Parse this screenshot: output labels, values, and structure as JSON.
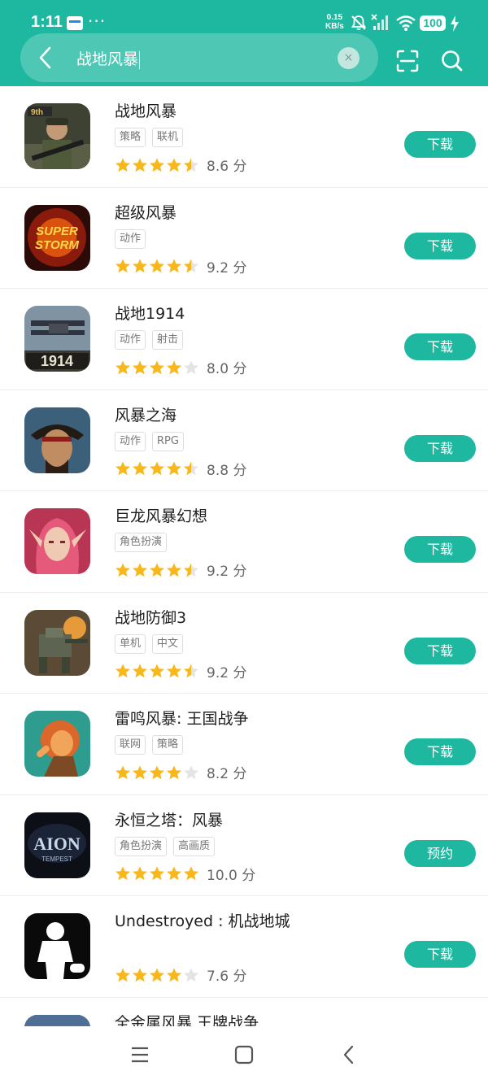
{
  "status_bar": {
    "time": "1:11",
    "more": "···",
    "net_speed_value": "0.15",
    "net_speed_unit": "KB/s",
    "battery": "100",
    "icons": [
      "calendar-icon",
      "mute-icon",
      "no-sim-signal-icon",
      "wifi-icon",
      "charging-icon"
    ]
  },
  "search": {
    "query": "战地风暴",
    "clear_label": "×",
    "icons": [
      "back-arrow-icon",
      "clear-icon",
      "scan-icon",
      "search-icon"
    ]
  },
  "colors": {
    "accent": "#1db89f",
    "star": "#f8b81c",
    "star_empty": "#e4e4e4"
  },
  "results": [
    {
      "name": "战地风暴",
      "tags": [
        "策略",
        "联机"
      ],
      "stars": 4.5,
      "score": "8.6 分",
      "button": "下载",
      "icon": "battlefield-soldier-icon"
    },
    {
      "name": "超级风暴",
      "tags": [
        "动作"
      ],
      "stars": 4.5,
      "score": "9.2 分",
      "button": "下载",
      "icon": "super-storm-logo-icon"
    },
    {
      "name": "战地1914",
      "tags": [
        "动作",
        "射击"
      ],
      "stars": 4,
      "score": "8.0 分",
      "button": "下载",
      "icon": "biplane-1914-icon"
    },
    {
      "name": "风暴之海",
      "tags": [
        "动作",
        "RPG"
      ],
      "stars": 4.5,
      "score": "8.8 分",
      "button": "下载",
      "icon": "pirate-captain-icon"
    },
    {
      "name": "巨龙风暴幻想",
      "tags": [
        "角色扮演"
      ],
      "stars": 4.5,
      "score": "9.2 分",
      "button": "下载",
      "icon": "elf-heroine-icon"
    },
    {
      "name": "战地防御3",
      "tags": [
        "单机",
        "中文"
      ],
      "stars": 4.5,
      "score": "9.2 分",
      "button": "下载",
      "icon": "mech-battle-icon"
    },
    {
      "name": "雷鸣风暴: 王国战争",
      "tags": [
        "联网",
        "策略"
      ],
      "stars": 4,
      "score": "8.2 分",
      "button": "下载",
      "icon": "lion-warrior-icon"
    },
    {
      "name": "永恒之塔：风暴",
      "tags": [
        "角色扮演",
        "高画质"
      ],
      "stars": 5,
      "score": "10.0 分",
      "button": "预约",
      "icon": "aion-tempest-logo-icon",
      "icon_text": "AION",
      "icon_subtext": "TEMPEST"
    },
    {
      "name": "Undestroyed : 机战地城",
      "tags": [],
      "stars": 4,
      "score": "7.6 分",
      "button": "下载",
      "icon": "silhouette-figure-icon"
    },
    {
      "name": "全金属风暴 王牌战争",
      "tags": [],
      "stars": 0,
      "score": "",
      "button": "",
      "icon": "metal-storm-icon"
    }
  ],
  "nav_bar": {
    "icons": [
      "menu-icon",
      "home-icon",
      "back-icon"
    ]
  }
}
